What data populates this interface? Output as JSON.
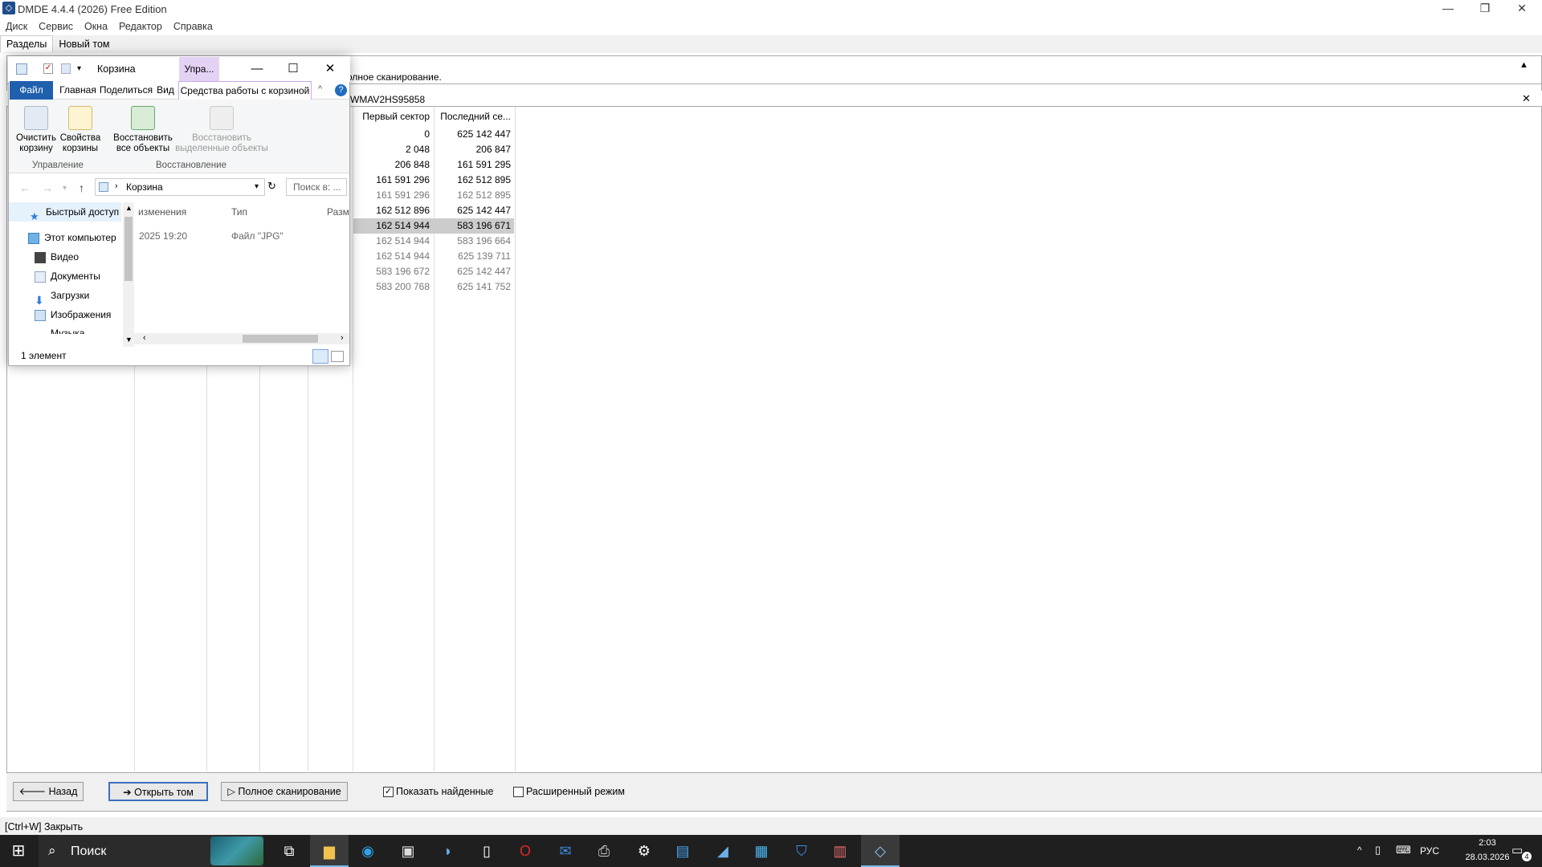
{
  "app": {
    "title": "DMDE 4.4.4 (2026) Free Edition",
    "menu": [
      "Диск",
      "Сервис",
      "Окна",
      "Редактор",
      "Справка"
    ],
    "tabs": [
      "Разделы",
      "Новый том"
    ],
    "hint": "олное сканирование.",
    "disk_title": "WMAV2HS95858",
    "window_controls": {
      "minimize": "—",
      "restore": "❐",
      "close": "✕"
    }
  },
  "table": {
    "headers": [
      "Первый сектор",
      "Последний се..."
    ],
    "rows": [
      {
        "first": "0",
        "last": "625 142 447",
        "dim": false,
        "selected": false
      },
      {
        "first": "2 048",
        "last": "206 847",
        "dim": false,
        "selected": false
      },
      {
        "first": "206 848",
        "last": "161 591 295",
        "dim": false,
        "selected": false
      },
      {
        "first": "161 591 296",
        "last": "162 512 895",
        "dim": false,
        "selected": false
      },
      {
        "first": "161 591 296",
        "last": "162 512 895",
        "dim": true,
        "selected": false
      },
      {
        "first": "162 512 896",
        "last": "625 142 447",
        "dim": false,
        "selected": false
      },
      {
        "first": "162 514 944",
        "last": "583 196 671",
        "dim": false,
        "selected": true
      },
      {
        "first": "162 514 944",
        "last": "583 196 664",
        "dim": true,
        "selected": false
      },
      {
        "first": "162 514 944",
        "last": "625 139 711",
        "dim": true,
        "selected": false
      },
      {
        "first": "583 196 672",
        "last": "625 142 447",
        "dim": true,
        "selected": false
      },
      {
        "first": "583 200 768",
        "last": "625 141 752",
        "dim": true,
        "selected": false
      }
    ]
  },
  "bottom": {
    "back": "Назад",
    "open_volume": "Открыть том",
    "full_scan": "Полное сканирование",
    "show_found": "Показать найденные",
    "show_found_checked": true,
    "extended_mode": "Расширенный режим",
    "extended_mode_checked": false
  },
  "status": "[Ctrl+W] Закрыть",
  "explorer": {
    "title": "Корзина",
    "manage_tab": "Упра...",
    "ribbon_tabs": [
      "Файл",
      "Главная",
      "Поделиться",
      "Вид",
      "Средства работы с корзиной"
    ],
    "buttons": {
      "empty_bin": "Очистить корзину",
      "bin_props": "Свойства корзины",
      "restore_all": "Восстановить все объекты",
      "restore_selected": "Восстановить выделенные объекты"
    },
    "groups": [
      "Управление",
      "Восстановление"
    ],
    "address": "Корзина",
    "search_placeholder": "Поиск в: ...",
    "nav": [
      "Быстрый доступ",
      "Этот компьютер",
      "Видео",
      "Документы",
      "Загрузки",
      "Изображения",
      "Музыка"
    ],
    "file_headers": [
      "изменения",
      "Тип",
      "Разм"
    ],
    "file_row": {
      "date": "2025 19:20",
      "type": "Файл \"JPG\""
    },
    "status": "1 элемент"
  },
  "taskbar": {
    "search_placeholder": "Поиск",
    "lang": "РУС",
    "time": "2:03",
    "date": "28.03.2026",
    "notifications": "4"
  }
}
